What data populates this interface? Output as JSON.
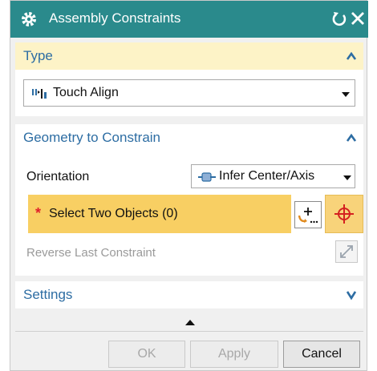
{
  "window": {
    "title": "Assembly Constraints",
    "icons": {
      "app": "gear-icon",
      "reset": "reset-icon",
      "close": "close-icon"
    }
  },
  "type_section": {
    "header": "Type",
    "expanded": true,
    "selected": "Touch Align",
    "selected_icon": "touch-align-icon"
  },
  "geometry_section": {
    "header": "Geometry to Constrain",
    "expanded": true,
    "orientation_label": "Orientation",
    "orientation_value": "Infer Center/Axis",
    "orientation_icon": "infer-center-axis-icon",
    "required_marker": "*",
    "select_prompt": "Select Two Objects (0)",
    "reverse_label": "Reverse Last Constraint"
  },
  "settings_section": {
    "header": "Settings",
    "expanded": false
  },
  "buttons": {
    "ok": "OK",
    "apply": "Apply",
    "cancel": "Cancel"
  },
  "colors": {
    "title_bar": "#2a8a8c",
    "section_header_text": "#2d6da3",
    "active_header_bg": "#fdf3c7",
    "selection_highlight": "#f8cf63",
    "required_star": "#e0202a"
  }
}
